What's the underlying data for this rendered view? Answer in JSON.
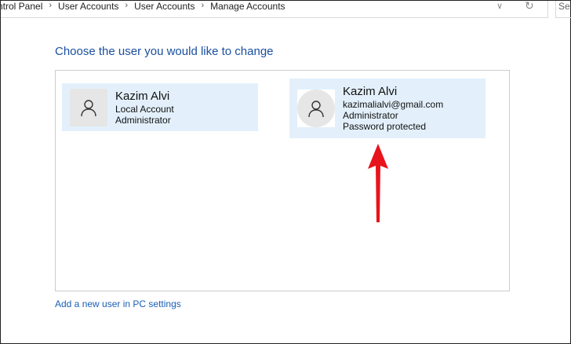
{
  "breadcrumb": [
    "ntrol Panel",
    "User Accounts",
    "User Accounts",
    "Manage Accounts"
  ],
  "search_placeholder": "Se",
  "title": "Choose the user you would like to change",
  "accounts": [
    {
      "name": "Kazim Alvi",
      "line1": "Local Account",
      "line2": "Administrator"
    },
    {
      "name": "Kazim Alvi",
      "line1": "kazimalialvi@gmail.com",
      "line2": "Administrator",
      "line3": "Password protected"
    }
  ],
  "add_user_link": "Add a new user in PC settings",
  "colors": {
    "accent": "#1a4fa0",
    "card": "#e3f0fb",
    "arrow": "#e8141b"
  }
}
